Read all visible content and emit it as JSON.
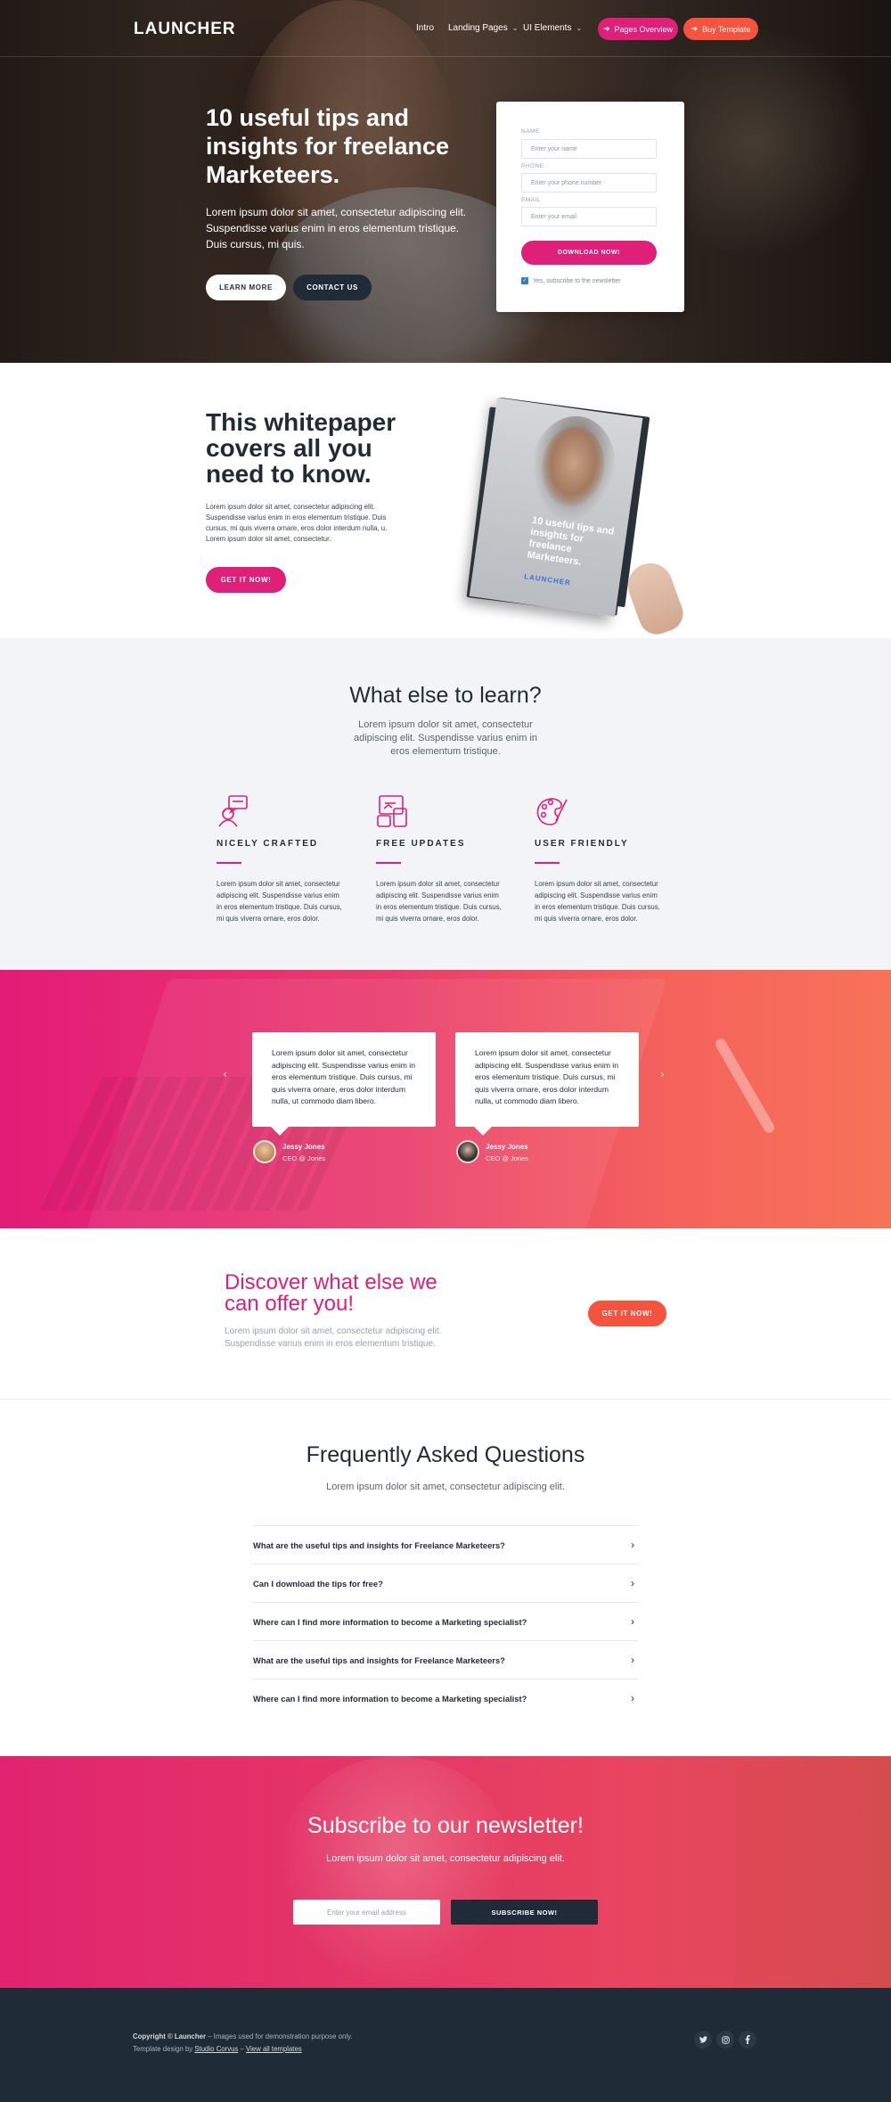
{
  "brand": {
    "logo": "LAUNCHER"
  },
  "nav": {
    "items": [
      {
        "label": "Intro"
      },
      {
        "label": "Landing Pages"
      },
      {
        "label": "UI Elements"
      }
    ],
    "pages_overview": "Pages Overview",
    "buy_template": "Buy Template"
  },
  "hero": {
    "title": "10 useful tips and insights for freelance Marketeers.",
    "text": "Lorem ipsum dolor sit amet, consectetur adipiscing elit. Suspendisse varius enim in eros elementum tristique. Duis cursus, mi quis.",
    "learn_more": "LEARN MORE",
    "contact_us": "CONTACT US"
  },
  "form": {
    "name_label": "NAME",
    "name_placeholder": "Enter your name",
    "phone_label": "PHONE",
    "phone_placeholder": "Enter your phone number",
    "email_label": "EMAIL",
    "email_placeholder": "Enter your email",
    "submit": "DOWNLOAD NOW!",
    "newsletter": "Yes, subscribe to the newsletter",
    "newsletter_checked": true
  },
  "whitepaper": {
    "title": "This whitepaper covers all you need to know.",
    "text": "Lorem ipsum dolor sit amet, consectetur adipiscing elit. Suspendisse varius enim in eros elementum tristique. Duis cursus, mi quis viverra ornare, eros dolor interdum nulla, u. Lorem ipsum dolor sit amet, consectetur.",
    "cta": "GET IT NOW!",
    "book_title": "10 useful tips and insights for freelance Marketeers.",
    "book_brand": "LAUNCHER"
  },
  "learn": {
    "title": "What else to learn?",
    "subtitle": "Lorem ipsum dolor sit amet, consectetur adipiscing elit. Suspendisse varius enim in eros elementum tristique.",
    "features": [
      {
        "icon": "support-agent-icon",
        "title": "NICELY CRAFTED",
        "text": "Lorem ipsum dolor sit amet, consectetur adipiscing elit. Suspendisse varius enim in eros elementum tristique. Duis cursus, mi quis viverra ornare, eros dolor."
      },
      {
        "icon": "devices-icon",
        "title": "FREE UPDATES",
        "text": "Lorem ipsum dolor sit amet, consectetur adipiscing elit. Suspendisse varius enim in eros elementum tristique. Duis cursus, mi quis viverra ornare, eros dolor."
      },
      {
        "icon": "palette-icon",
        "title": "USER FRIENDLY",
        "text": "Lorem ipsum dolor sit amet, consectetur adipiscing elit. Suspendisse varius enim in eros elementum tristique. Duis cursus, mi quis viverra ornare, eros dolor."
      }
    ],
    "accent": "#e01f79"
  },
  "testimonials": [
    {
      "quote": "Lorem ipsum dolor sit amet, consectetur adipiscing elit. Suspendisse varius enim in eros elementum tristique. Duis cursus, mi quis viverra ornare, eros dolor interdum nulla, ut commodo diam libero.",
      "name": "Jessy Jones",
      "role": "CEO @ Jones"
    },
    {
      "quote": "Lorem ipsum dolor sit amet, consectetur adipiscing elit. Suspendisse varius enim in eros elementum tristique. Duis cursus, mi quis viverra ornare, eros dolor interdum nulla, ut commodo diam libero.",
      "name": "Jessy Jones",
      "role": "CEO @ Jones"
    }
  ],
  "discover": {
    "title": "Discover what else we can offer you!",
    "text": "Lorem ipsum dolor sit amet, consectetur adipiscing elit. Suspendisse varius enim in eros elementum tristique.",
    "cta": "GET IT NOW!"
  },
  "faq": {
    "title": "Frequently Asked Questions",
    "subtitle": "Lorem ipsum dolor sit amet, consectetur adipiscing elit.",
    "items": [
      "What are the useful tips and insights for Freelance Marketeers?",
      "Can I download the tips for free?",
      "Where can I find more information to become a Marketing specialist?",
      "What are the useful tips and insights for Freelance Marketeers?",
      "Where can I find more information to become a Marketing specialist?"
    ]
  },
  "subscribe": {
    "title": "Subscribe to our newsletter!",
    "text": "Lorem ipsum dolor sit amet, consectetur adipiscing elit.",
    "placeholder": "Enter your email address",
    "button": "SUBSCRIBE NOW!"
  },
  "footer": {
    "copyright": "Copyright © Launcher",
    "copyright_rest": " – Images used for demonstration purpose only.",
    "design_prefix": "Template design by ",
    "designer": "Studio Corvus",
    "sep": " – ",
    "all_templates": "View all templates",
    "social": [
      "twitter-icon",
      "instagram-icon",
      "facebook-icon"
    ]
  },
  "colors": {
    "pink": "#e01f79",
    "orange": "#f5533d",
    "dark": "#1f2b36"
  }
}
